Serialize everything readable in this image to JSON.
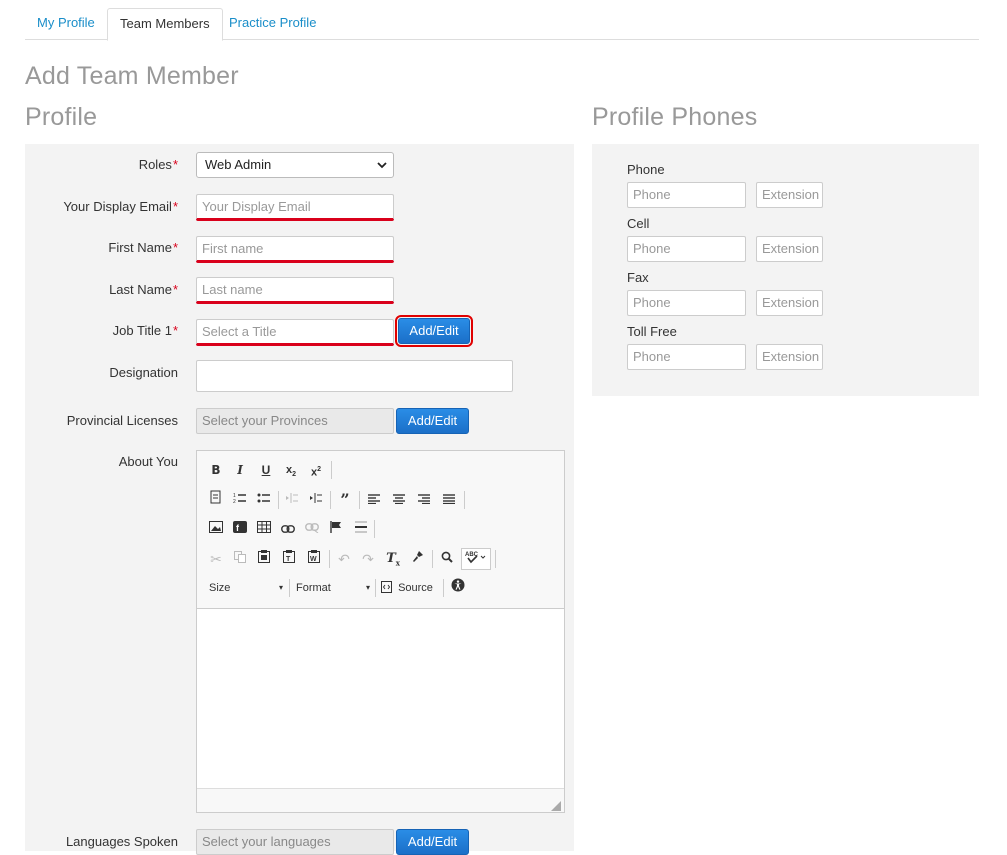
{
  "tabs": [
    {
      "label": "My Profile"
    },
    {
      "label": "Team Members"
    },
    {
      "label": "Practice Profile"
    }
  ],
  "page_title": "Add Team Member",
  "profile": {
    "heading": "Profile",
    "roles": {
      "label": "Roles",
      "value": "Web Admin"
    },
    "display_email": {
      "label": "Your Display Email",
      "placeholder": "Your Display Email"
    },
    "first_name": {
      "label": "First Name",
      "placeholder": "First name"
    },
    "last_name": {
      "label": "Last Name",
      "placeholder": "Last name"
    },
    "job_title": {
      "label": "Job Title 1",
      "placeholder": "Select a Title",
      "button": "Add/Edit"
    },
    "designation": {
      "label": "Designation",
      "value": ""
    },
    "licenses": {
      "label": "Provincial Licenses",
      "placeholder": "Select your Provinces",
      "button": "Add/Edit"
    },
    "about": {
      "label": "About You"
    },
    "languages": {
      "label": "Languages Spoken",
      "placeholder": "Select your languages",
      "button": "Add/Edit"
    },
    "required_mark": "*"
  },
  "editor": {
    "size_label": "Size",
    "format_label": "Format",
    "source_label": "Source"
  },
  "phones": {
    "heading": "Profile Phones",
    "items": [
      {
        "label": "Phone",
        "phone_placeholder": "Phone",
        "ext_placeholder": "Extension"
      },
      {
        "label": "Cell",
        "phone_placeholder": "Phone",
        "ext_placeholder": "Extension"
      },
      {
        "label": "Fax",
        "phone_placeholder": "Phone",
        "ext_placeholder": "Extension"
      },
      {
        "label": "Toll Free",
        "phone_placeholder": "Phone",
        "ext_placeholder": "Extension"
      }
    ]
  }
}
